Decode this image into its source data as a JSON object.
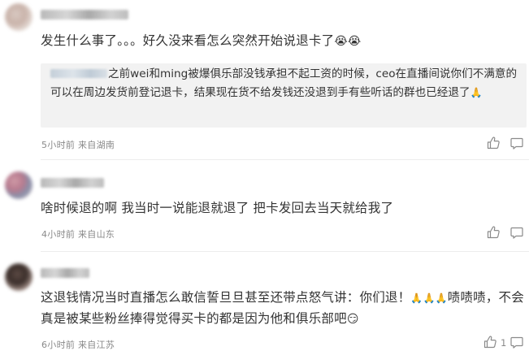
{
  "comments": [
    {
      "text": "发生什么事了。。。好久没来看怎么突然开始说退卡了",
      "text_emoji": "😭😭",
      "quote": {
        "text": "之前wei和ming被爆俱乐部没钱承担不起工资的时候，ceo在直播间说你们不满意的可以在周边发货前登记退卡，结果现在货不给发钱还没退到手有些听话的群也已经退了",
        "emoji": "🙏"
      },
      "time": "5小时前",
      "location": "来自湖南"
    },
    {
      "text": "啥时候退的啊 我当时一说能退就退了 把卡发回去当天就给我了",
      "time": "4小时前",
      "location": "来自山东"
    },
    {
      "text_part1": "这退钱情况当时直播怎么敢信誓旦旦甚至还带点怒气讲：你们退！",
      "text_emoji1": "🙏🙏🙏",
      "text_part2": "啧啧啧，不会真是被某些粉丝捧得觉得买卡的都是因为他和俱乐部吧",
      "text_emoji2": "😏",
      "time": "6小时前",
      "location": "来自江苏",
      "like_count": "1"
    }
  ],
  "icons": [
    "like-icon",
    "reply-icon"
  ],
  "colors": {
    "meta": "#8a8a8a",
    "quote_bg": "#f2f2f2",
    "text": "#333333"
  }
}
